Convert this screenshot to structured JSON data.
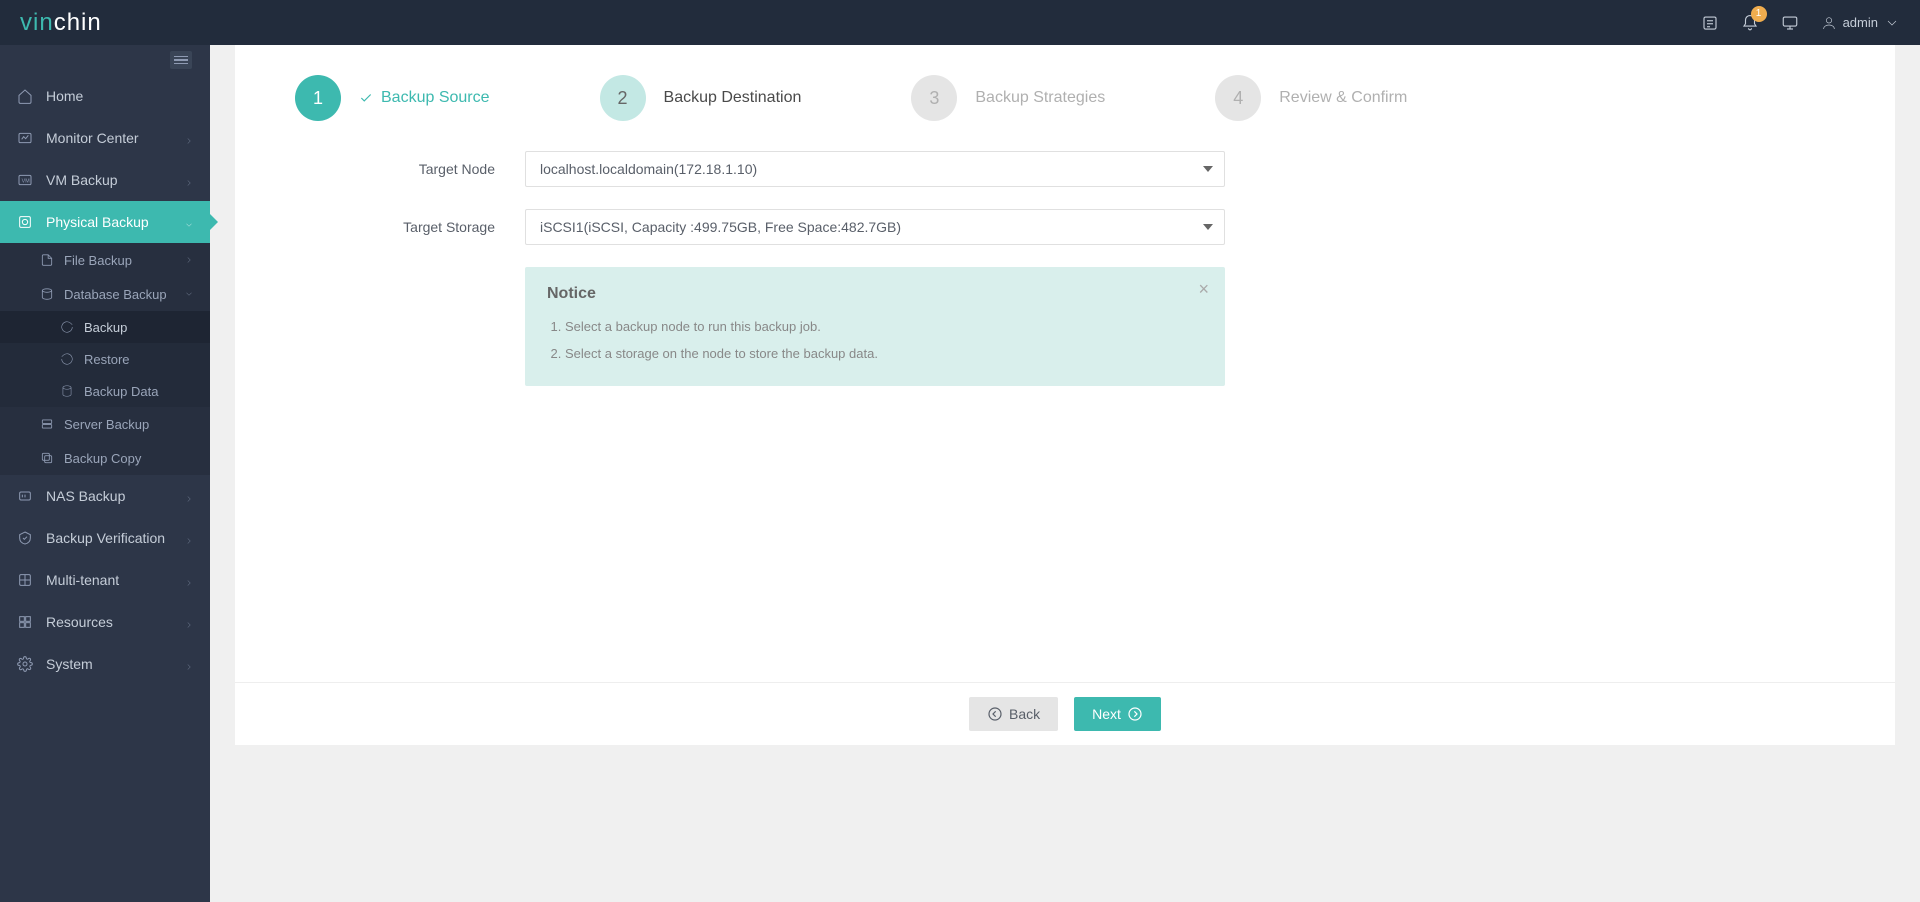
{
  "brand": {
    "part1": "vin",
    "part2": "chin"
  },
  "header": {
    "notification_count": "1",
    "user_label": "admin"
  },
  "sidebar": {
    "home": "Home",
    "monitor_center": "Monitor Center",
    "vm_backup": "VM Backup",
    "physical_backup": "Physical Backup",
    "file_backup": "File Backup",
    "database_backup": "Database Backup",
    "db_backup": "Backup",
    "db_restore": "Restore",
    "db_backup_data": "Backup Data",
    "server_backup": "Server Backup",
    "backup_copy": "Backup Copy",
    "nas_backup": "NAS Backup",
    "backup_verification": "Backup Verification",
    "multi_tenant": "Multi-tenant",
    "resources": "Resources",
    "system": "System"
  },
  "wizard": {
    "step1": {
      "num": "1",
      "label": "Backup Source"
    },
    "step2": {
      "num": "2",
      "label": "Backup Destination"
    },
    "step3": {
      "num": "3",
      "label": "Backup Strategies"
    },
    "step4": {
      "num": "4",
      "label": "Review & Confirm"
    }
  },
  "form": {
    "target_node_label": "Target Node",
    "target_node_value": "localhost.localdomain(172.18.1.10)",
    "target_storage_label": "Target Storage",
    "target_storage_value": "iSCSI1(iSCSI, Capacity :499.75GB, Free Space:482.7GB)"
  },
  "notice": {
    "title": "Notice",
    "items": [
      "Select a backup node to run this backup job.",
      "Select a storage on the node to store the backup data."
    ]
  },
  "buttons": {
    "back": "Back",
    "next": "Next"
  }
}
